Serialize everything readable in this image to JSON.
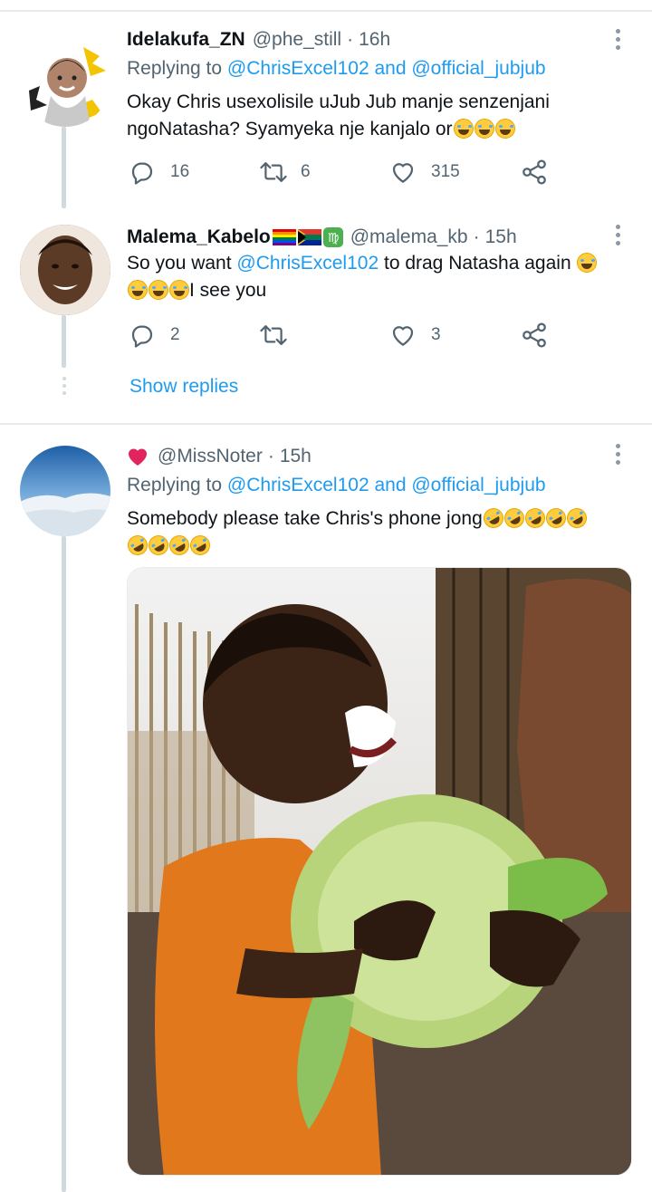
{
  "tweets": [
    {
      "username": "Idelakufa_ZN",
      "handle": "@phe_still",
      "separator": "·",
      "time": "16h",
      "replying_prefix": "Replying to",
      "replying_to_1": "@ChrisExcel102",
      "replying_and": "and",
      "replying_to_2": "@official_jubjub",
      "text_line1": "Okay Chris usexolisile uJub Jub manje senzenjani",
      "text_line2": "ngoNatasha? Syamyeka nje kanjalo or",
      "text_emojis": "😂😂😂",
      "replies": "16",
      "retweets": "6",
      "likes": "315"
    },
    {
      "username": "Malema_Kabelo",
      "name_emojis": "🏳️‍🌈🇿🇦♍",
      "handle": "@malema_kb",
      "separator": "·",
      "time": "15h",
      "text_prefix": "So you want",
      "mention": "@ChrisExcel102",
      "text_suffix": "to drag Natasha again",
      "text_line2": "I see you",
      "text_emojis": "😂😂😂😂",
      "replies": "2",
      "retweets": "",
      "likes": "3"
    },
    {
      "name_emoji": "❤️",
      "handle": "@MissNoter",
      "separator": "·",
      "time": "15h",
      "replying_prefix": "Replying to",
      "replying_to_1": "@ChrisExcel102",
      "replying_and": "and",
      "replying_to_2": "@official_jubjub",
      "text_line1": "Somebody please take Chris's phone jong",
      "text_emojis": "🤣🤣🤣🤣🤣🤣🤣🤣🤣"
    }
  ],
  "show_replies_label": "Show replies",
  "colors": {
    "accent": "#1d9bf0",
    "secondary_text": "#536471",
    "divider": "#e6ecf0",
    "heart_red": "#e0245e"
  },
  "icons": [
    "reply-icon",
    "retweet-icon",
    "like-icon",
    "share-icon",
    "more-icon"
  ]
}
